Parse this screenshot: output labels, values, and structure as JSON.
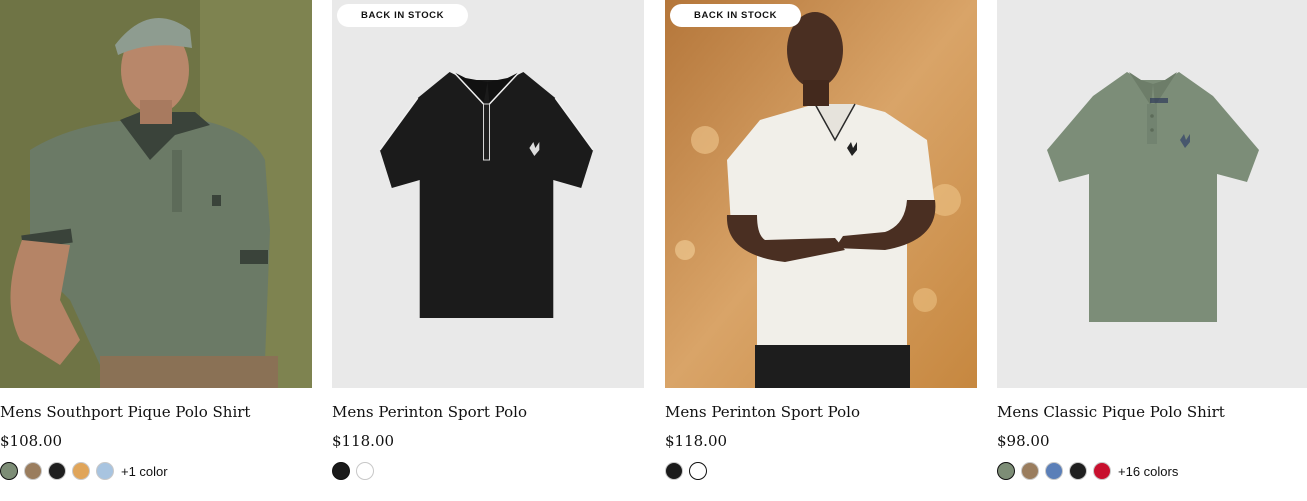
{
  "products": [
    {
      "title": "Mens Southport Pique Polo Shirt",
      "price": "$108.00",
      "badge": "",
      "swatches": [
        "#7d8d76",
        "#9a7d5e",
        "#1f1f1f",
        "#e0a55a",
        "#a8c4e0"
      ],
      "selected_swatch": 0,
      "more_colors": "+1 color"
    },
    {
      "title": "Mens Perinton Sport Polo",
      "price": "$118.00",
      "badge": "BACK IN STOCK",
      "swatches": [
        "#1a1a1a",
        "#ffffff"
      ],
      "selected_swatch": 0,
      "more_colors": ""
    },
    {
      "title": "Mens Perinton Sport Polo",
      "price": "$118.00",
      "badge": "BACK IN STOCK",
      "swatches": [
        "#1a1a1a",
        "#ffffff"
      ],
      "selected_swatch": 1,
      "more_colors": ""
    },
    {
      "title": "Mens Classic Pique Polo Shirt",
      "price": "$98.00",
      "badge": "",
      "swatches": [
        "#7d8d76",
        "#9a7d5e",
        "#5b7fb8",
        "#1f1f1f",
        "#c8102e"
      ],
      "selected_swatch": 0,
      "more_colors": "+16 colors"
    }
  ],
  "colors": {
    "photo_bg_olive": "#6f7445",
    "studio_bg": "#e9e9e9",
    "photo_bg_warm": "#c98a45"
  }
}
